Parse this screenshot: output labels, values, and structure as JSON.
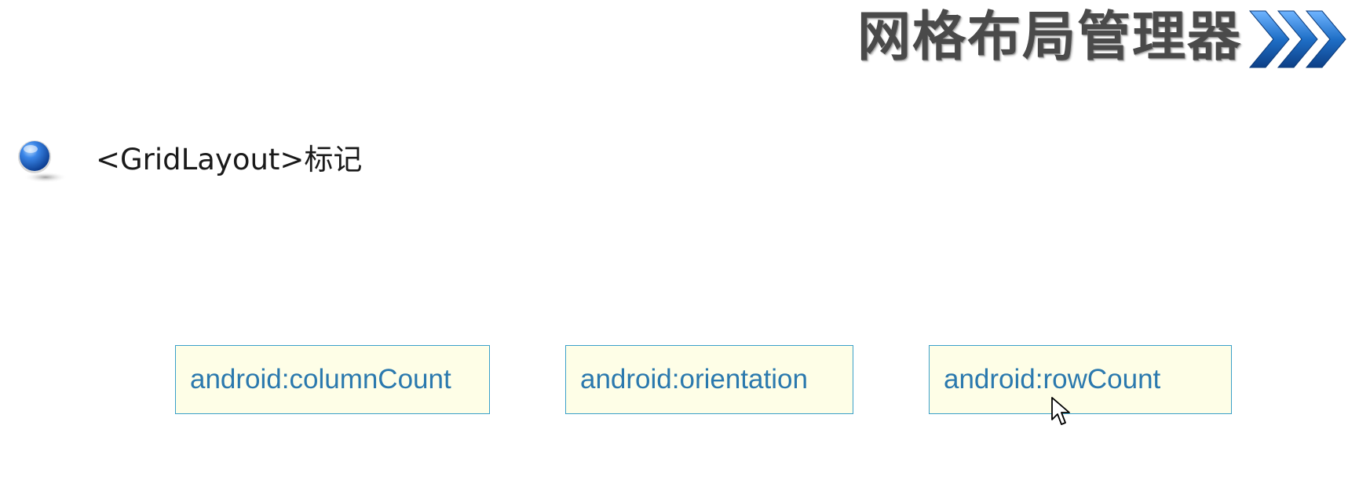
{
  "slide": {
    "title": "网格布局管理器",
    "bullet_text": "<GridLayout>标记",
    "attributes": [
      "android:columnCount",
      "android:orientation",
      "android:rowCount"
    ]
  },
  "icons": {
    "title_decoration": "triple-chevron-right-icon",
    "bullet": "blue-sphere-bullet-icon",
    "cursor": "mouse-pointer-icon"
  },
  "colors": {
    "title": "#4a4a4a",
    "arrow_blue": "#1f6fc7",
    "box_border": "#3aa0c9",
    "box_fill": "#fefee7",
    "box_text": "#2b79ae"
  }
}
